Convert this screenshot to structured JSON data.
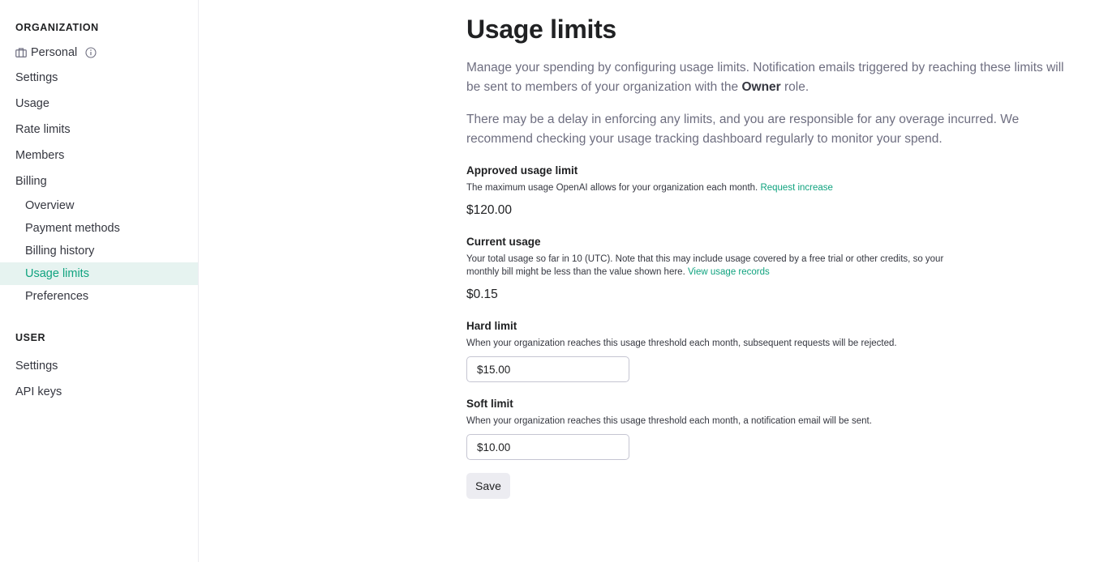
{
  "sidebar": {
    "organization_heading": "ORGANIZATION",
    "org_name": "Personal",
    "org_items": [
      {
        "label": "Settings"
      },
      {
        "label": "Usage"
      },
      {
        "label": "Rate limits"
      },
      {
        "label": "Members"
      },
      {
        "label": "Billing"
      }
    ],
    "billing_items": [
      {
        "label": "Overview"
      },
      {
        "label": "Payment methods"
      },
      {
        "label": "Billing history"
      },
      {
        "label": "Usage limits",
        "active": true
      },
      {
        "label": "Preferences"
      }
    ],
    "user_heading": "USER",
    "user_items": [
      {
        "label": "Settings"
      },
      {
        "label": "API keys"
      }
    ]
  },
  "main": {
    "title": "Usage limits",
    "intro1_a": "Manage your spending by configuring usage limits. Notification emails triggered by reaching these limits will be sent to members of your organization with the ",
    "intro1_bold": "Owner",
    "intro1_b": " role.",
    "intro2": "There may be a delay in enforcing any limits, and you are responsible for any overage incurred. We recommend checking your usage tracking dashboard regularly to monitor your spend.",
    "approved": {
      "title": "Approved usage limit",
      "desc": "The maximum usage OpenAI allows for your organization each month. ",
      "link": "Request increase",
      "value": "$120.00"
    },
    "current": {
      "title": "Current usage",
      "desc": "Your total usage so far in 10 (UTC). Note that this may include usage covered by a free trial or other credits, so your monthly bill might be less than the value shown here. ",
      "link": "View usage records",
      "value": "$0.15"
    },
    "hard": {
      "title": "Hard limit",
      "desc": "When your organization reaches this usage threshold each month, subsequent requests will be rejected.",
      "value": "$15.00"
    },
    "soft": {
      "title": "Soft limit",
      "desc": "When your organization reaches this usage threshold each month, a notification email will be sent.",
      "value": "$10.00"
    },
    "save_label": "Save"
  },
  "colors": {
    "accent": "#10a37f",
    "active_bg": "#e6f3f0"
  },
  "icons": {
    "org": "briefcase-icon",
    "info": "info-icon"
  }
}
